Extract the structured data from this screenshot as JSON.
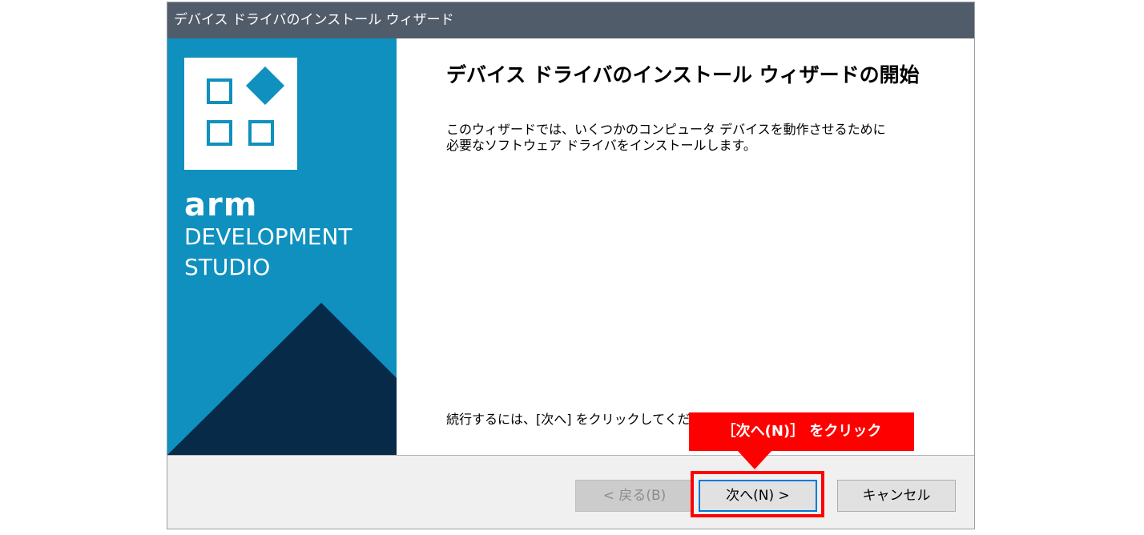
{
  "window": {
    "title": "デバイス ドライバのインストール ウィザード"
  },
  "sidebar": {
    "brand_primary": "arm",
    "brand_line1": "DEVELOPMENT",
    "brand_line2": "STUDIO",
    "colors": {
      "background": "#0f90be",
      "mountain": "#062a48"
    }
  },
  "main": {
    "heading": "デバイス ドライバのインストール ウィザードの開始",
    "description_line1": "このウィザードでは、いくつかのコンピュータ デバイスを動作させるために",
    "description_line2": "必要なソフトウェア ドライバをインストールします。",
    "continue_text": "続行するには、[次へ] をクリックしてください。"
  },
  "footer": {
    "back_label": "< 戻る(B)",
    "next_label": "次へ(N) >",
    "cancel_label": "キャンセル"
  },
  "annotation": {
    "callout_text": "［次へ(N)］ をクリック",
    "color": "#ff0000"
  }
}
